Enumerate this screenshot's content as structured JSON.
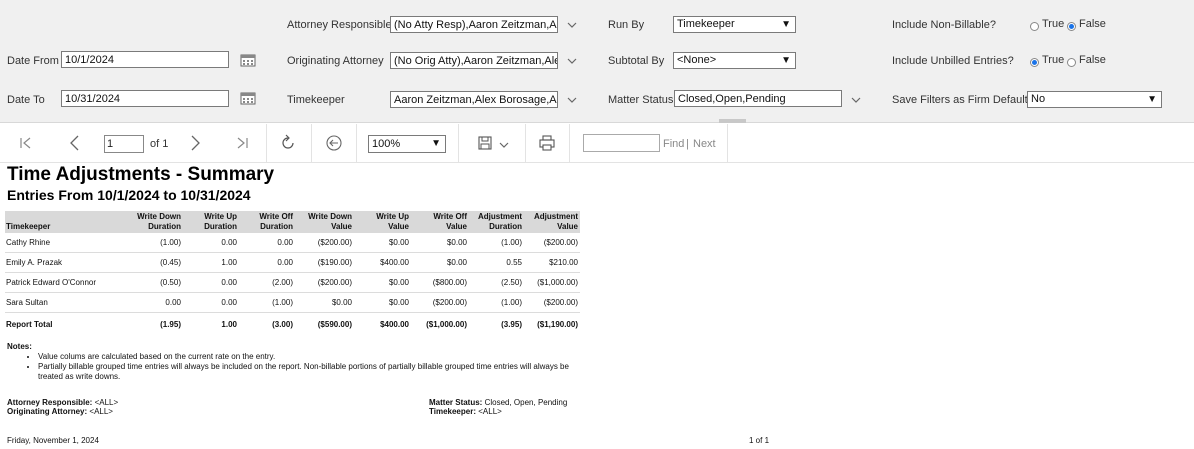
{
  "params": {
    "attorney_responsible": {
      "label": "Attorney Responsible",
      "value": "(No Atty Resp),Aaron Zeitzman,Ale"
    },
    "originating_attorney": {
      "label": "Originating Attorney",
      "value": "(No Orig Atty),Aaron Zeitzman,Ale"
    },
    "timekeeper": {
      "label": "Timekeeper",
      "value": "Aaron Zeitzman,Alex Borosage,Ale"
    },
    "date_from": {
      "label": "Date From",
      "value": "10/1/2024"
    },
    "date_to": {
      "label": "Date To",
      "value": "10/31/2024"
    },
    "run_by": {
      "label": "Run By",
      "value": "Timekeeper"
    },
    "subtotal_by": {
      "label": "Subtotal By",
      "value": "<None>"
    },
    "matter_status": {
      "label": "Matter Status",
      "value": "Closed,Open,Pending"
    },
    "include_non_billable": {
      "label": "Include Non-Billable?",
      "true_label": "True",
      "false_label": "False",
      "selected": "False"
    },
    "include_unbilled": {
      "label": "Include Unbilled Entries?",
      "true_label": "True",
      "false_label": "False",
      "selected": "True"
    },
    "save_filters": {
      "label": "Save Filters as Firm Default?",
      "value": "No"
    }
  },
  "toolbar": {
    "page_value": "1",
    "page_of": "of 1",
    "zoom": "100%",
    "find_placeholder": "",
    "find_label": "Find",
    "separator": "|",
    "next_label": "Next"
  },
  "report": {
    "title": "Time Adjustments - Summary",
    "subtitle": "Entries From 10/1/2024 to 10/31/2024",
    "headers": [
      [
        "Timekeeper",
        ""
      ],
      [
        "Write Down",
        "Duration"
      ],
      [
        "Write Up",
        "Duration"
      ],
      [
        "Write Off",
        "Duration"
      ],
      [
        "Write Down",
        "Value"
      ],
      [
        "Write Up",
        "Value"
      ],
      [
        "Write Off",
        "Value"
      ],
      [
        "Adjustment",
        "Duration"
      ],
      [
        "Adjustment",
        "Value"
      ]
    ],
    "rows": [
      [
        "Cathy Rhine",
        "(1.00)",
        "0.00",
        "0.00",
        "($200.00)",
        "$0.00",
        "$0.00",
        "(1.00)",
        "($200.00)"
      ],
      [
        "Emily A. Prazak",
        "(0.45)",
        "1.00",
        "0.00",
        "($190.00)",
        "$400.00",
        "$0.00",
        "0.55",
        "$210.00"
      ],
      [
        "Patrick Edward O'Connor",
        "(0.50)",
        "0.00",
        "(2.00)",
        "($200.00)",
        "$0.00",
        "($800.00)",
        "(2.50)",
        "($1,000.00)"
      ],
      [
        "Sara Sultan",
        "0.00",
        "0.00",
        "(1.00)",
        "$0.00",
        "$0.00",
        "($200.00)",
        "(1.00)",
        "($200.00)"
      ]
    ],
    "total": [
      "Report Total",
      "(1.95)",
      "1.00",
      "(3.00)",
      "($590.00)",
      "$400.00",
      "($1,000.00)",
      "(3.95)",
      "($1,190.00)"
    ],
    "notes_title": "Notes:",
    "notes": [
      "Value colums are calculated based on the current rate on the entry.",
      "Partially billable grouped time entries will always be included on the report. Non-billable portions of partially billable grouped time entries will always be treated as write downs."
    ],
    "filters": {
      "attorney_responsible_label": "Attorney Responsible:",
      "attorney_responsible_value": "<ALL>",
      "originating_attorney_label": "Originating Attorney:",
      "originating_attorney_value": "<ALL>",
      "matter_status_label": "Matter Status:",
      "matter_status_value": "Closed, Open, Pending",
      "timekeeper_label": "Timekeeper:",
      "timekeeper_value": "<ALL>"
    },
    "footer_date": "Friday, November 1, 2024",
    "footer_page": "1 of 1"
  }
}
